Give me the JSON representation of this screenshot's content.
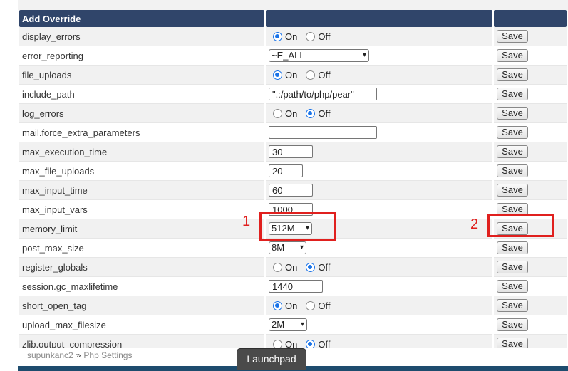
{
  "table": {
    "header": {
      "title": "Add Override"
    },
    "rows": [
      {
        "name": "display_errors",
        "type": "radio",
        "on_label": "On",
        "off_label": "Off",
        "selected": "On",
        "save_label": "Save"
      },
      {
        "name": "error_reporting",
        "type": "select",
        "value": "~E_ALL",
        "save_label": "Save"
      },
      {
        "name": "file_uploads",
        "type": "radio",
        "on_label": "On",
        "off_label": "Off",
        "selected": "On",
        "save_label": "Save"
      },
      {
        "name": "include_path",
        "type": "text",
        "value": "\".:/path/to/php/pear\"",
        "save_label": "Save"
      },
      {
        "name": "log_errors",
        "type": "radio",
        "on_label": "On",
        "off_label": "Off",
        "selected": "Off",
        "save_label": "Save"
      },
      {
        "name": "mail.force_extra_parameters",
        "type": "text",
        "value": "",
        "save_label": "Save"
      },
      {
        "name": "max_execution_time",
        "type": "text",
        "value": "30",
        "save_label": "Save"
      },
      {
        "name": "max_file_uploads",
        "type": "text",
        "value": "20",
        "save_label": "Save"
      },
      {
        "name": "max_input_time",
        "type": "text",
        "value": "60",
        "save_label": "Save"
      },
      {
        "name": "max_input_vars",
        "type": "text",
        "value": "1000",
        "save_label": "Save"
      },
      {
        "name": "memory_limit",
        "type": "select",
        "value": "512M",
        "save_label": "Save"
      },
      {
        "name": "post_max_size",
        "type": "select",
        "value": "8M",
        "save_label": "Save"
      },
      {
        "name": "register_globals",
        "type": "radio",
        "on_label": "On",
        "off_label": "Off",
        "selected": "Off",
        "save_label": "Save"
      },
      {
        "name": "session.gc_maxlifetime",
        "type": "text",
        "value": "1440",
        "save_label": "Save"
      },
      {
        "name": "short_open_tag",
        "type": "radio",
        "on_label": "On",
        "off_label": "Off",
        "selected": "On",
        "save_label": "Save"
      },
      {
        "name": "upload_max_filesize",
        "type": "select",
        "value": "2M",
        "save_label": "Save"
      },
      {
        "name": "zlib.output_compression",
        "type": "radio",
        "on_label": "On",
        "off_label": "Off",
        "selected": "Off",
        "save_label": "Save"
      }
    ]
  },
  "annotations": {
    "label_1": "1",
    "label_2": "2",
    "color": "#e0201e"
  },
  "breadcrumb": {
    "account": "supunkanc2",
    "separator": "»",
    "page": "Php Settings"
  },
  "launchpad": {
    "label": "Launchpad"
  },
  "colors": {
    "header_bg": "#30456a",
    "radio_accent": "#1a73e8",
    "bottom_bar": "#1e4c6e"
  }
}
